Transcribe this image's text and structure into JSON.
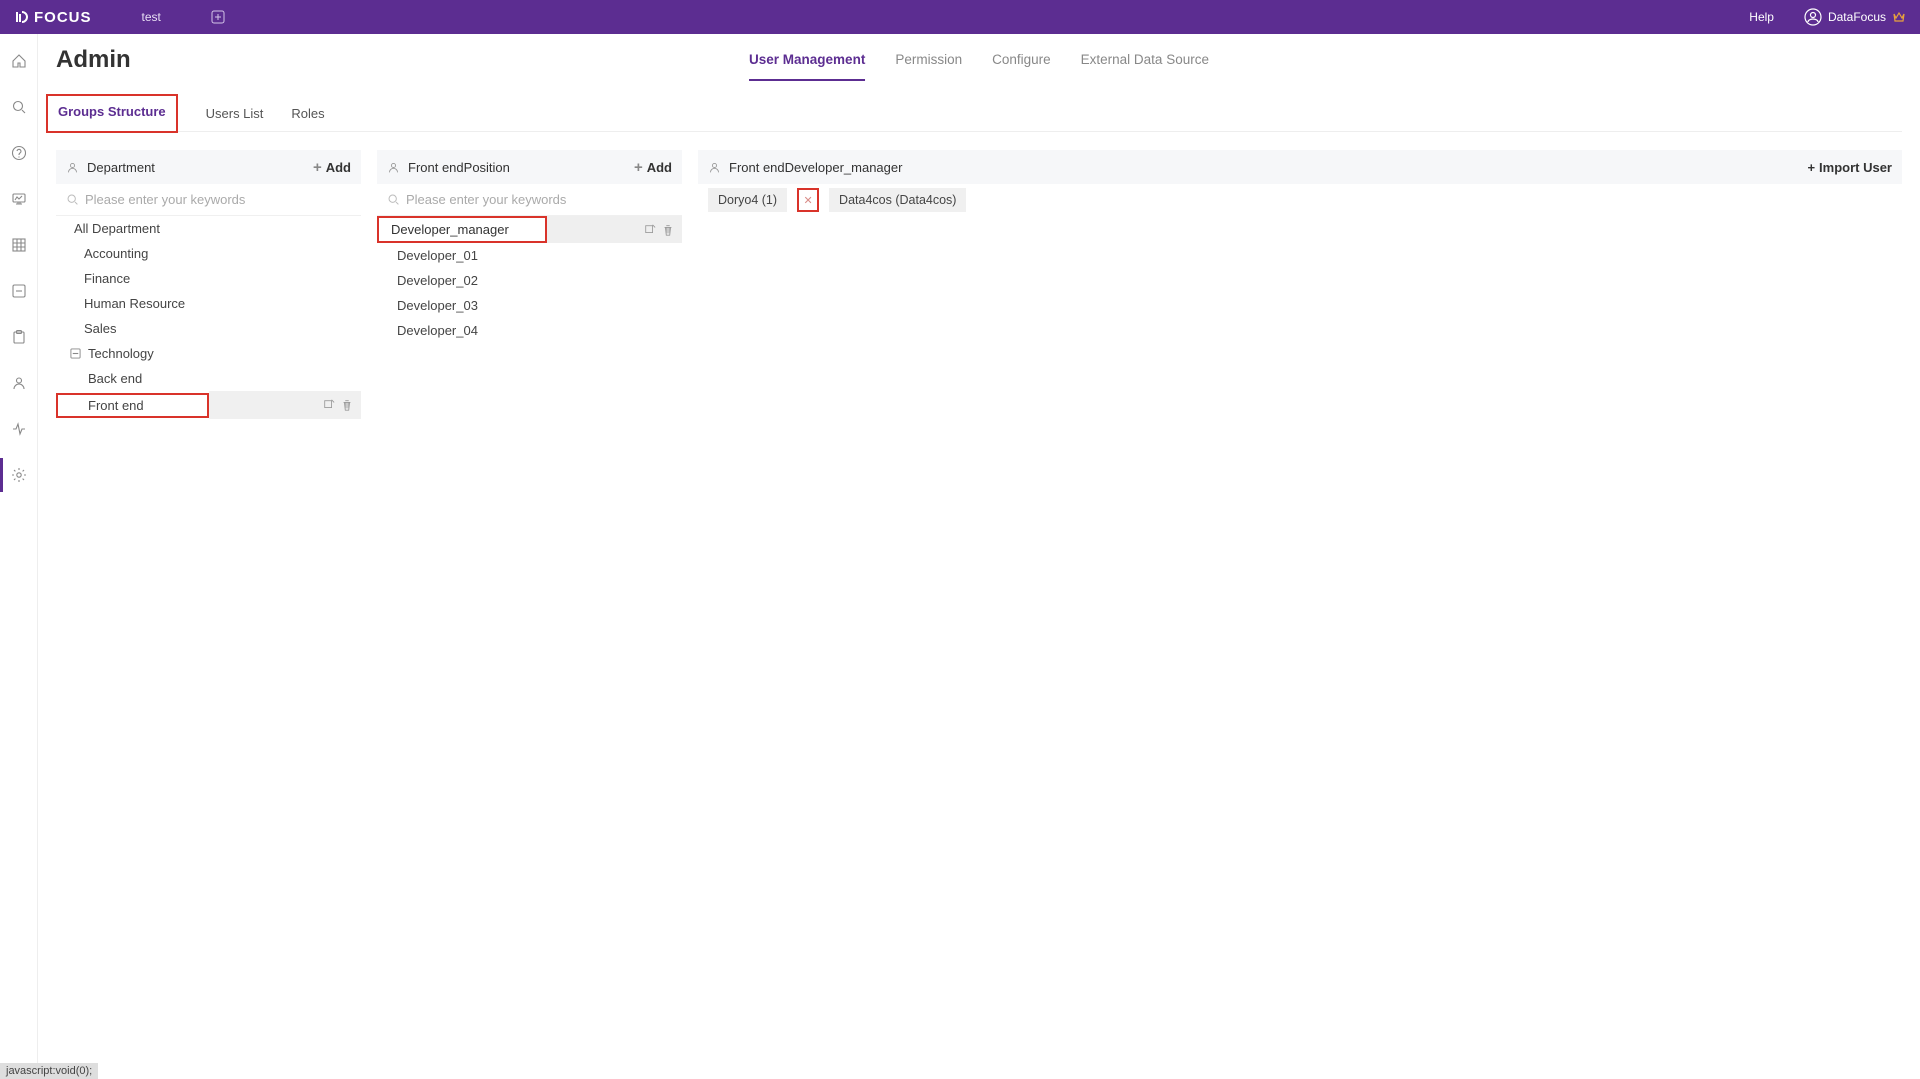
{
  "topbar": {
    "brand": "FOCUS",
    "tab": "test",
    "help": "Help",
    "user": "DataFocus"
  },
  "page": {
    "title": "Admin"
  },
  "top_tabs": {
    "user_mgmt": "User Management",
    "permission": "Permission",
    "configure": "Configure",
    "external": "External Data Source"
  },
  "sub_tabs": {
    "groups": "Groups Structure",
    "users": "Users List",
    "roles": "Roles"
  },
  "dept": {
    "header": "Department",
    "add": "Add",
    "search_placeholder": "Please enter your keywords",
    "all": "All Department",
    "items": {
      "accounting": "Accounting",
      "finance": "Finance",
      "hr": "Human Resource",
      "sales": "Sales",
      "technology": "Technology",
      "backend": "Back end",
      "frontend": "Front end"
    }
  },
  "position": {
    "header": "Front endPosition",
    "add": "Add",
    "search_placeholder": "Please enter your keywords",
    "items": {
      "devmgr": "Developer_manager",
      "dev01": "Developer_01",
      "dev02": "Developer_02",
      "dev03": "Developer_03",
      "dev04": "Developer_04"
    }
  },
  "users": {
    "header": "Front endDeveloper_manager",
    "import": "Import User",
    "chips": {
      "doryo": "Doryo4 (1)",
      "data4cos": "Data4cos (Data4cos)"
    }
  },
  "statusbar": "javascript:void(0);"
}
